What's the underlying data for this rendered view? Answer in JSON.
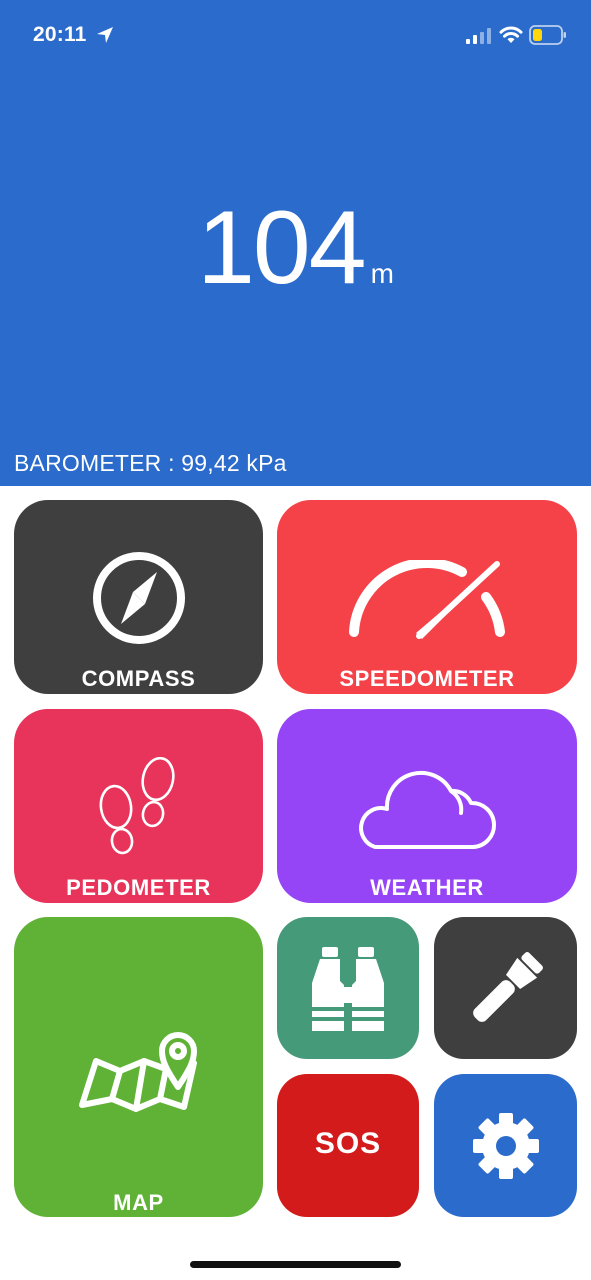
{
  "status_bar": {
    "time": "20:11",
    "location_icon": "location-arrow-icon",
    "signal_icon": "cellular-signal-icon",
    "wifi_icon": "wifi-icon",
    "battery_icon": "battery-low-icon"
  },
  "header": {
    "altitude_value": "104",
    "altitude_unit": "m",
    "barometer": "BAROMETER : 99,42 kPa"
  },
  "tiles": {
    "compass": {
      "label": "COMPASS",
      "icon": "compass-icon",
      "color": "#3f3f3f"
    },
    "speedometer": {
      "label": "SPEEDOMETER",
      "icon": "speedometer-icon",
      "color": "#f44248"
    },
    "pedometer": {
      "label": "PEDOMETER",
      "icon": "footprints-icon",
      "color": "#e8335a"
    },
    "weather": {
      "label": "WEATHER",
      "icon": "cloud-icon",
      "color": "#9645f6"
    },
    "map": {
      "label": "MAP",
      "icon": "map-pin-icon",
      "color": "#60b237"
    },
    "binoculars": {
      "icon": "binoculars-icon",
      "color": "#459a7a"
    },
    "flashlight": {
      "icon": "flashlight-icon",
      "color": "#3f3f3f"
    },
    "sos": {
      "label": "SOS",
      "color": "#d31b1b"
    },
    "settings": {
      "icon": "gear-icon",
      "color": "#2a6bcb"
    }
  },
  "colors": {
    "header_bg": "#2a6bcb",
    "page_bg": "#ffffff"
  }
}
